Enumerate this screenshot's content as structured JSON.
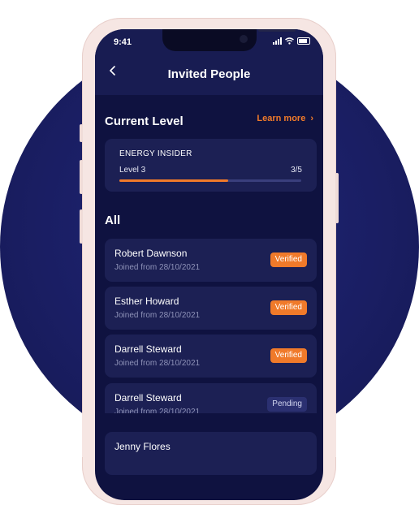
{
  "status_bar": {
    "time": "9:41"
  },
  "header": {
    "back_icon": "chevron-left-icon",
    "title": "Invited People"
  },
  "current_level": {
    "title": "Current Level",
    "learn_more": "Learn more",
    "card": {
      "name": "ENERGY INSIDER",
      "level_label": "Level 3",
      "progress_text": "3/5",
      "progress_fraction": 0.6
    }
  },
  "all": {
    "title": "All",
    "people": [
      {
        "name": "Robert Dawnson",
        "joined": "Joined from 28/10/2021",
        "status": "Verified"
      },
      {
        "name": "Esther Howard",
        "joined": "Joined from 28/10/2021",
        "status": "Verified"
      },
      {
        "name": "Darrell Steward",
        "joined": "Joined from 28/10/2021",
        "status": "Verified"
      },
      {
        "name": "Darrell Steward",
        "joined": "Joined from 28/10/2021",
        "status": "Pending"
      },
      {
        "name": "Jenny Flores",
        "joined": "",
        "status": ""
      }
    ]
  },
  "colors": {
    "accent": "#f07a2a",
    "background": "#0f1240",
    "card": "#1c2054"
  }
}
